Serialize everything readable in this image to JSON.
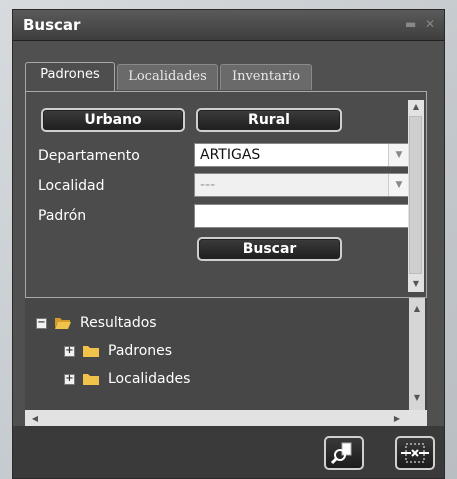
{
  "window": {
    "title": "Buscar",
    "minimize_glyph": "▬",
    "close_glyph": "✕"
  },
  "tabs": [
    {
      "label": "Padrones",
      "active": true
    },
    {
      "label": "Localidades",
      "active": false
    },
    {
      "label": "Inventario",
      "active": false
    }
  ],
  "form": {
    "urbano_label": "Urbano",
    "rural_label": "Rural",
    "departamento_label": "Departamento",
    "departamento_value": "ARTIGAS",
    "localidad_label": "Localidad",
    "localidad_value": "---",
    "padron_label": "Padrón",
    "padron_value": "",
    "buscar_label": "Buscar"
  },
  "tree": {
    "root_label": "Resultados",
    "children": [
      {
        "label": "Padrones"
      },
      {
        "label": "Localidades"
      }
    ]
  },
  "footer": {
    "zoom_button_icon": "zoom-to-result-icon",
    "clear_button_icon": "clear-results-icon"
  },
  "colors": {
    "window_bg": "#505050",
    "folder": "#f2c34a",
    "button_border": "#d0d0d0"
  }
}
